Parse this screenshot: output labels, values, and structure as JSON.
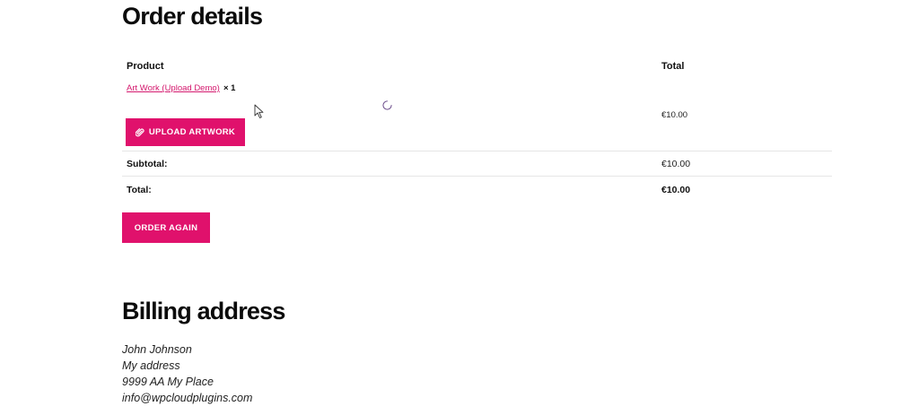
{
  "order_details": {
    "heading": "Order details",
    "columns": {
      "product": "Product",
      "total": "Total"
    },
    "item": {
      "name": "Art Work (Upload Demo)",
      "quantity": "× 1",
      "price": "€10.00",
      "upload_button": {
        "label": "UPLOAD ARTWORK",
        "icon": "paperclip-icon"
      }
    },
    "subtotal": {
      "label": "Subtotal:",
      "value": "€10.00"
    },
    "total": {
      "label": "Total:",
      "value": "€10.00"
    },
    "order_again_label": "ORDER AGAIN"
  },
  "billing_address": {
    "heading": "Billing address",
    "lines": [
      "John Johnson",
      "My address",
      "9999 AA My Place",
      "info@wpcloudplugins.com"
    ]
  },
  "colors": {
    "accent": "#e0116c",
    "link": "#d4196e"
  }
}
